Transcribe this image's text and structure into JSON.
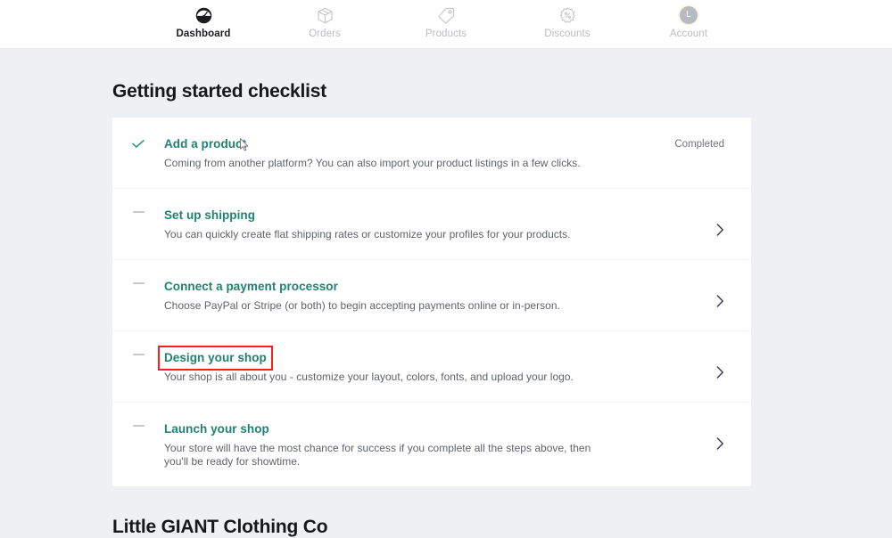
{
  "nav": {
    "items": [
      {
        "label": "Dashboard",
        "icon": "dashboard-gauge-icon",
        "active": true
      },
      {
        "label": "Orders",
        "icon": "package-box-icon",
        "active": false
      },
      {
        "label": "Products",
        "icon": "price-tag-icon",
        "active": false
      },
      {
        "label": "Discounts",
        "icon": "percent-badge-icon",
        "active": false
      },
      {
        "label": "Account",
        "icon": "avatar-icon",
        "active": false,
        "avatar_initial": "L"
      }
    ]
  },
  "main": {
    "checklist_title": "Getting started checklist",
    "shop_title": "Little GIANT Clothing Co",
    "checklist": [
      {
        "title": "Add a product",
        "desc": "Coming from another platform? You can also import your product listings in a few clicks.",
        "marker": "check",
        "status": "Completed",
        "has_chevron": false,
        "highlighted": false
      },
      {
        "title": "Set up shipping",
        "desc": "You can quickly create flat shipping rates or customize your profiles for your products.",
        "marker": "dash",
        "status": "",
        "has_chevron": true,
        "highlighted": false
      },
      {
        "title": "Connect a payment processor",
        "desc": "Choose PayPal or Stripe (or both) to begin accepting payments online or in-person.",
        "marker": "dash",
        "status": "",
        "has_chevron": true,
        "highlighted": false
      },
      {
        "title": "Design your shop",
        "desc": "Your shop is all about you - customize your layout, colors, fonts, and upload your logo.",
        "marker": "dash",
        "status": "",
        "has_chevron": true,
        "highlighted": true
      },
      {
        "title": "Launch your shop",
        "desc": "Your store will have the most chance for success if you complete all the steps above, then you'll be ready for showtime.",
        "marker": "dash",
        "status": "",
        "has_chevron": true,
        "highlighted": false
      }
    ]
  },
  "colors": {
    "page_bg": "#eff0f3",
    "card_bg": "#ffffff",
    "link_teal": "#1f8272",
    "annotation_red": "#f8201c",
    "muted_text": "#5f636c",
    "nav_inactive": "#b9bcc4"
  }
}
